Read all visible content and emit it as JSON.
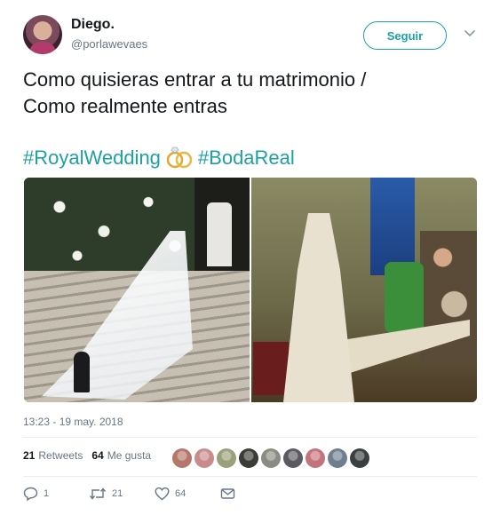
{
  "author": {
    "name": "Diego.",
    "handle": "@porlawevaes",
    "follow_label": "Seguir"
  },
  "tweet": {
    "text_lines": [
      "Como quisieras entrar a tu matrimonio /",
      "Como realmente entras"
    ],
    "hashtags": [
      "#RoyalWedding",
      "#BodaReal"
    ],
    "timestamp": "13:23 - 19 may. 2018"
  },
  "stats": {
    "retweets_count": "21",
    "retweets_label": "Retweets",
    "likes_count": "64",
    "likes_label": "Me gusta"
  },
  "likers_colors": [
    "#b4776a",
    "#c98a8c",
    "#9aa07a",
    "#3b3b38",
    "#8c8c84",
    "#5a5a60",
    "#c4737c",
    "#6f7f8e",
    "#3a4040"
  ],
  "actions": {
    "reply_count": "1",
    "retweet_count": "21",
    "like_count": "64"
  },
  "colors": {
    "accent": "#1da1a1",
    "muted": "#657786"
  },
  "icons": [
    "chevron-down-icon",
    "wedding-rings-icon",
    "reply-icon",
    "retweet-icon",
    "heart-icon",
    "message-icon"
  ]
}
